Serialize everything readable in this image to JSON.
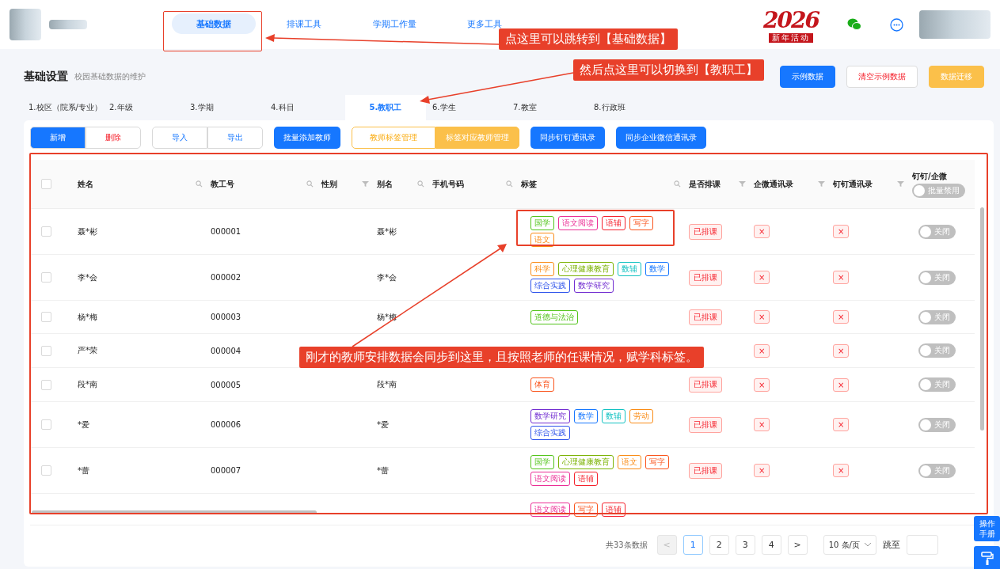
{
  "header": {
    "nav": [
      {
        "label": "基础数据",
        "selected": true
      },
      {
        "label": "排课工具",
        "selected": false
      },
      {
        "label": "学期工作量",
        "selected": false
      },
      {
        "label": "更多工具",
        "selected": false
      }
    ],
    "event_logo": {
      "year": "2026",
      "caption": "新年活动"
    }
  },
  "page": {
    "title": "基础设置",
    "subtitle": "校园基础数据的维护",
    "actions": [
      {
        "label": "示例数据",
        "kind": "primary"
      },
      {
        "label": "清空示例数据",
        "kind": "danger"
      },
      {
        "label": "数据迁移",
        "kind": "warning"
      }
    ]
  },
  "tabs": [
    {
      "label": "1.校区（院系/专业）",
      "selected": false
    },
    {
      "label": "2.年级",
      "selected": false
    },
    {
      "label": "3.学期",
      "selected": false
    },
    {
      "label": "4.科目",
      "selected": false
    },
    {
      "label": "5.教职工",
      "selected": true
    },
    {
      "label": "6.学生",
      "selected": false
    },
    {
      "label": "7.教室",
      "selected": false
    },
    {
      "label": "8.行政班",
      "selected": false
    }
  ],
  "toolbar": [
    {
      "kind": "group",
      "buttons": [
        {
          "label": "新增",
          "selected": true,
          "kind": "default"
        },
        {
          "label": "删除",
          "selected": false,
          "kind": "danger"
        }
      ]
    },
    {
      "kind": "group",
      "buttons": [
        {
          "label": "导入",
          "selected": false,
          "kind": "default"
        },
        {
          "label": "导出",
          "selected": false,
          "kind": "default"
        }
      ]
    },
    {
      "kind": "primary",
      "label": "批量添加教师"
    },
    {
      "kind": "group",
      "buttons": [
        {
          "label": "教师标签管理",
          "selected": false,
          "kind": "warning"
        },
        {
          "label": "标签对应教师管理",
          "selected": true,
          "kind": "warning"
        }
      ]
    },
    {
      "kind": "primary",
      "label": "同步钉钉通讯录"
    },
    {
      "kind": "primary",
      "label": "同步企业微信通讯录"
    }
  ],
  "table": {
    "columns": [
      {
        "label": "姓名",
        "kind": "search"
      },
      {
        "label": "教工号",
        "kind": "search"
      },
      {
        "label": "性别",
        "kind": "filter"
      },
      {
        "label": "别名",
        "kind": "search"
      },
      {
        "label": "手机号码",
        "kind": "search"
      },
      {
        "label": "标签",
        "kind": "search"
      },
      {
        "label": "是否排课",
        "kind": "filter"
      },
      {
        "label": "企微通讯录",
        "kind": "filter"
      },
      {
        "label": "钉钉通讯录",
        "kind": "filter"
      },
      {
        "label": "钉钉/企微",
        "kind": "toggle"
      }
    ],
    "header_checked": false,
    "bulk_toggle": {
      "label": "批量禁用",
      "on": false
    },
    "rows": [
      {
        "checked": false,
        "name": "聂*彬",
        "id": "000001",
        "alias": "聂*彬",
        "tags": [
          {
            "label": "国学",
            "color": "#52c41a"
          },
          {
            "label": "语文阅读",
            "color": "#eb2f96"
          },
          {
            "label": "语辅",
            "color": "#f5222d"
          },
          {
            "label": "写字",
            "color": "#fa541c"
          },
          {
            "label": "语文",
            "color": "#fa8c16"
          }
        ],
        "scheduled": "已排课",
        "wecom": "×",
        "dingtalk": "×",
        "toggle": {
          "label": "关闭",
          "on": false
        }
      },
      {
        "checked": false,
        "name": "李*会",
        "id": "000002",
        "alias": "李*会",
        "tags": [
          {
            "label": "科学",
            "color": "#fa8c16"
          },
          {
            "label": "心理健康教育",
            "color": "#7cb305"
          },
          {
            "label": "数辅",
            "color": "#13c2c2"
          },
          {
            "label": "数学",
            "color": "#1677ff"
          },
          {
            "label": "综合实践",
            "color": "#2f54eb"
          },
          {
            "label": "数学研究",
            "color": "#722ed1"
          }
        ],
        "scheduled": "已排课",
        "wecom": "×",
        "dingtalk": "×",
        "toggle": {
          "label": "关闭",
          "on": false
        }
      },
      {
        "checked": false,
        "name": "杨*梅",
        "id": "000003",
        "alias": "杨*梅",
        "tags": [
          {
            "label": "道德与法治",
            "color": "#52c41a"
          }
        ],
        "scheduled": "已排课",
        "wecom": "×",
        "dingtalk": "×",
        "toggle": {
          "label": "关闭",
          "on": false
        }
      },
      {
        "checked": false,
        "name": "严*荣",
        "id": "000004",
        "wecom": "×",
        "dingtalk": "×",
        "toggle": {
          "label": "关闭",
          "on": false
        }
      },
      {
        "checked": false,
        "name": "段*南",
        "id": "000005",
        "alias": "段*南",
        "tags": [
          {
            "label": "体育",
            "color": "#fa541c"
          }
        ],
        "scheduled": "已排课",
        "wecom": "×",
        "dingtalk": "×",
        "toggle": {
          "label": "关闭",
          "on": false
        }
      },
      {
        "checked": false,
        "name": "*爱",
        "id": "000006",
        "alias": "*爱",
        "tags": [
          {
            "label": "数学研究",
            "color": "#722ed1"
          },
          {
            "label": "数学",
            "color": "#1677ff"
          },
          {
            "label": "数辅",
            "color": "#13c2c2"
          },
          {
            "label": "劳动",
            "color": "#fa8c16"
          },
          {
            "label": "综合实践",
            "color": "#2f54eb"
          }
        ],
        "scheduled": "已排课",
        "wecom": "×",
        "dingtalk": "×",
        "toggle": {
          "label": "关闭",
          "on": false
        }
      },
      {
        "checked": false,
        "name": "*蕾",
        "id": "000007",
        "alias": "*蕾",
        "tags": [
          {
            "label": "国学",
            "color": "#52c41a"
          },
          {
            "label": "心理健康教育",
            "color": "#7cb305"
          },
          {
            "label": "语文",
            "color": "#fa8c16"
          },
          {
            "label": "写字",
            "color": "#fa541c"
          },
          {
            "label": "语文阅读",
            "color": "#eb2f96"
          },
          {
            "label": "语辅",
            "color": "#f5222d"
          }
        ],
        "scheduled": "已排课",
        "wecom": "×",
        "dingtalk": "×",
        "toggle": {
          "label": "关闭",
          "on": false
        }
      },
      {
        "tags": [
          {
            "label": "语文阅读",
            "color": "#eb2f96"
          },
          {
            "label": "写字",
            "color": "#fa541c"
          },
          {
            "label": "语辅",
            "color": "#f5222d"
          }
        ]
      }
    ]
  },
  "pagination": {
    "total": "共33条数据",
    "prev": "<",
    "pages": [
      {
        "label": "1",
        "selected": true
      },
      {
        "label": "2",
        "selected": false
      },
      {
        "label": "3",
        "selected": false
      },
      {
        "label": "4",
        "selected": false
      }
    ],
    "next": ">",
    "page_size": "10 条/页",
    "jump_label": "跳至"
  },
  "help_button": "操作手册",
  "annotations": [
    {
      "kind": "top",
      "text": "点这里可以跳转到【基础数据】"
    },
    {
      "kind": "mid",
      "text": "然后点这里可以切换到【教职工】"
    },
    {
      "kind": "table",
      "text": "刚才的教师安排数据会同步到这里，且按照老师的任课情况，赋学科标签。"
    }
  ]
}
